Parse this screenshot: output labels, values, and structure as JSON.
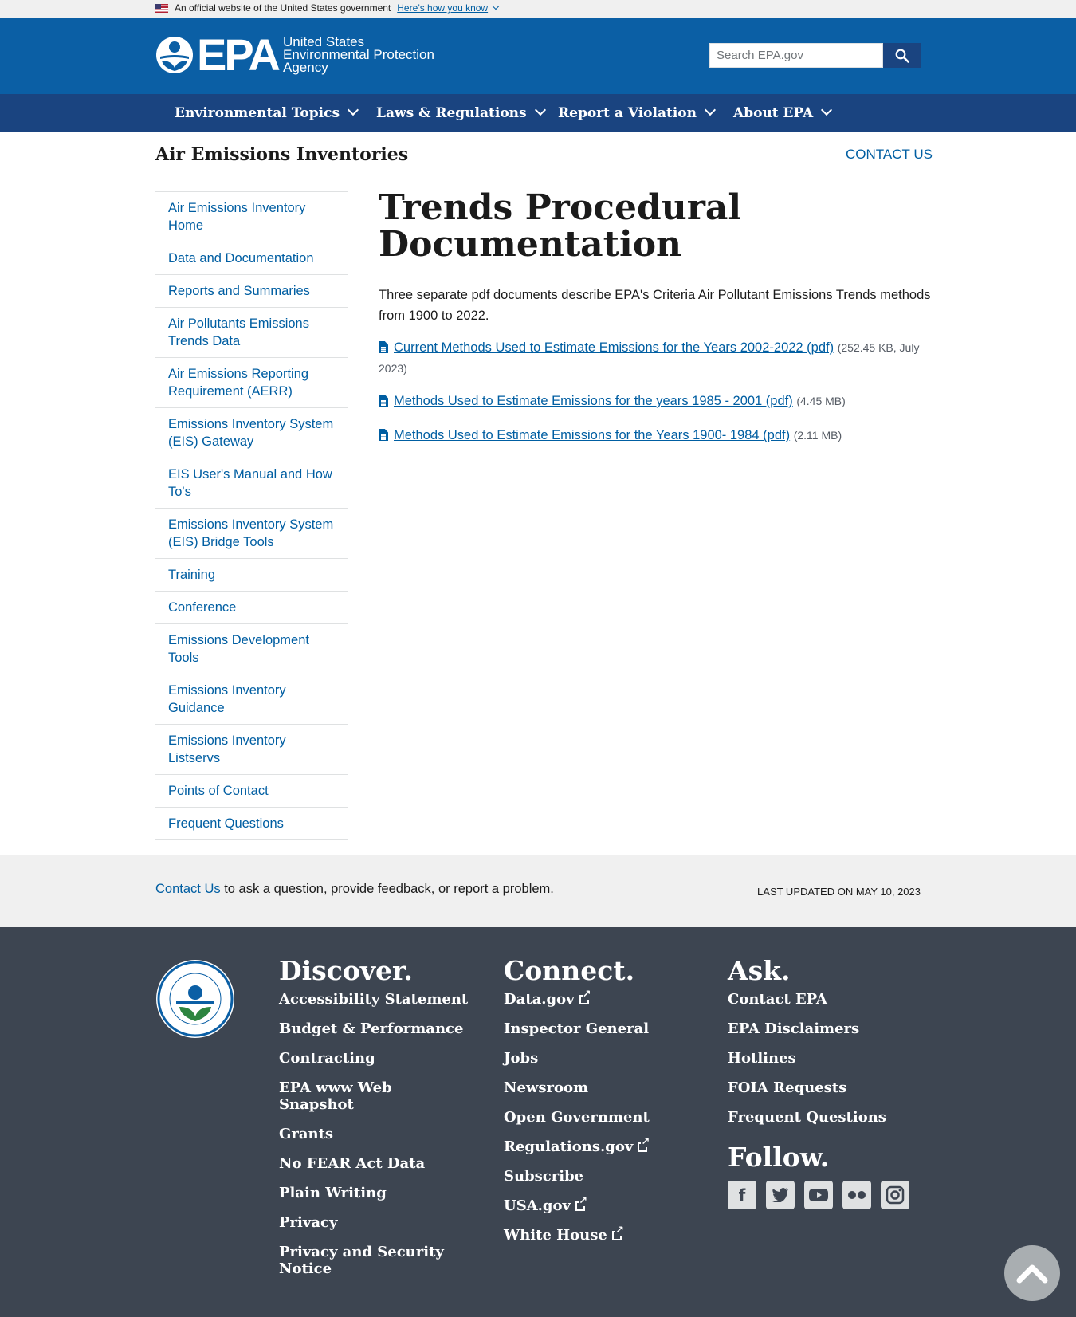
{
  "gov_banner": {
    "text": "An official website of the United States government",
    "link": "Here’s how you know"
  },
  "header": {
    "logo_text": "EPA",
    "logo_lines": [
      "United States",
      "Environmental Protection",
      "Agency"
    ],
    "search_placeholder": "Search EPA.gov"
  },
  "nav": [
    {
      "label": "Environmental Topics"
    },
    {
      "label": "Laws & Regulations"
    },
    {
      "label": "Report a Violation"
    },
    {
      "label": "About EPA"
    }
  ],
  "site_title": "Air Emissions Inventories",
  "contact_us": "CONTACT US",
  "sidebar": [
    "Air Emissions Inventory Home",
    "Data and Documentation",
    "Reports and Summaries",
    "Air Pollutants Emissions Trends Data",
    "Air Emissions Reporting Requirement (AERR)",
    "Emissions Inventory System (EIS) Gateway",
    "EIS User's Manual and How To's",
    "Emissions Inventory System (EIS) Bridge Tools",
    "Training",
    "Conference",
    "Emissions Development Tools",
    "Emissions Inventory Guidance",
    "Emissions Inventory Listservs",
    "Points of Contact",
    "Frequent Questions"
  ],
  "main": {
    "title": "Trends Procedural Documentation",
    "intro": "Three separate pdf documents describe EPA's Criteria Air Pollutant Emissions Trends methods from 1900 to 2022.",
    "docs": [
      {
        "link": "Current Methods Used to Estimate Emissions for the Years 2002-2022 (pdf)",
        "meta": "(252.45 KB, July 2023)"
      },
      {
        "link": "Methods Used to Estimate Emissions for the years 1985 - 2001 (pdf)",
        "meta": "(4.45 MB)"
      },
      {
        "link": "Methods Used to Estimate Emissions for the Years 1900- 1984 (pdf)",
        "meta": "(2.11 MB)"
      }
    ]
  },
  "contact_bar": {
    "link": "Contact Us",
    "text": " to ask a question, provide feedback, or report a problem.",
    "updated": "LAST UPDATED ON MAY 10, 2023"
  },
  "footer": {
    "seal_text": "UNITED STATES · ENVIRONMENTAL PROTECTION AGENCY",
    "discover": {
      "heading": "Discover.",
      "links": [
        "Accessibility Statement",
        "Budget & Performance",
        "Contracting",
        "EPA www Web Snapshot",
        "Grants",
        "No FEAR Act Data",
        "Plain Writing",
        "Privacy",
        "Privacy and Security Notice"
      ]
    },
    "connect": {
      "heading": "Connect.",
      "links": [
        "Data.gov",
        "Inspector General",
        "Jobs",
        "Newsroom",
        "Open Government",
        "Regulations.gov",
        "Subscribe",
        "USA.gov",
        "White House"
      ]
    },
    "ask": {
      "heading": "Ask.",
      "links": [
        "Contact EPA",
        "EPA Disclaimers",
        "Hotlines",
        "FOIA Requests",
        "Frequent Questions"
      ]
    },
    "follow": {
      "heading": "Follow.",
      "icons": [
        "facebook-icon",
        "twitter-icon",
        "youtube-icon",
        "flickr-icon",
        "instagram-icon"
      ]
    }
  },
  "colors": {
    "header_blue": "#0b5fa5",
    "nav_blue": "#1a4480",
    "link_blue": "#005ea2",
    "footer_gray": "#3d4551"
  }
}
